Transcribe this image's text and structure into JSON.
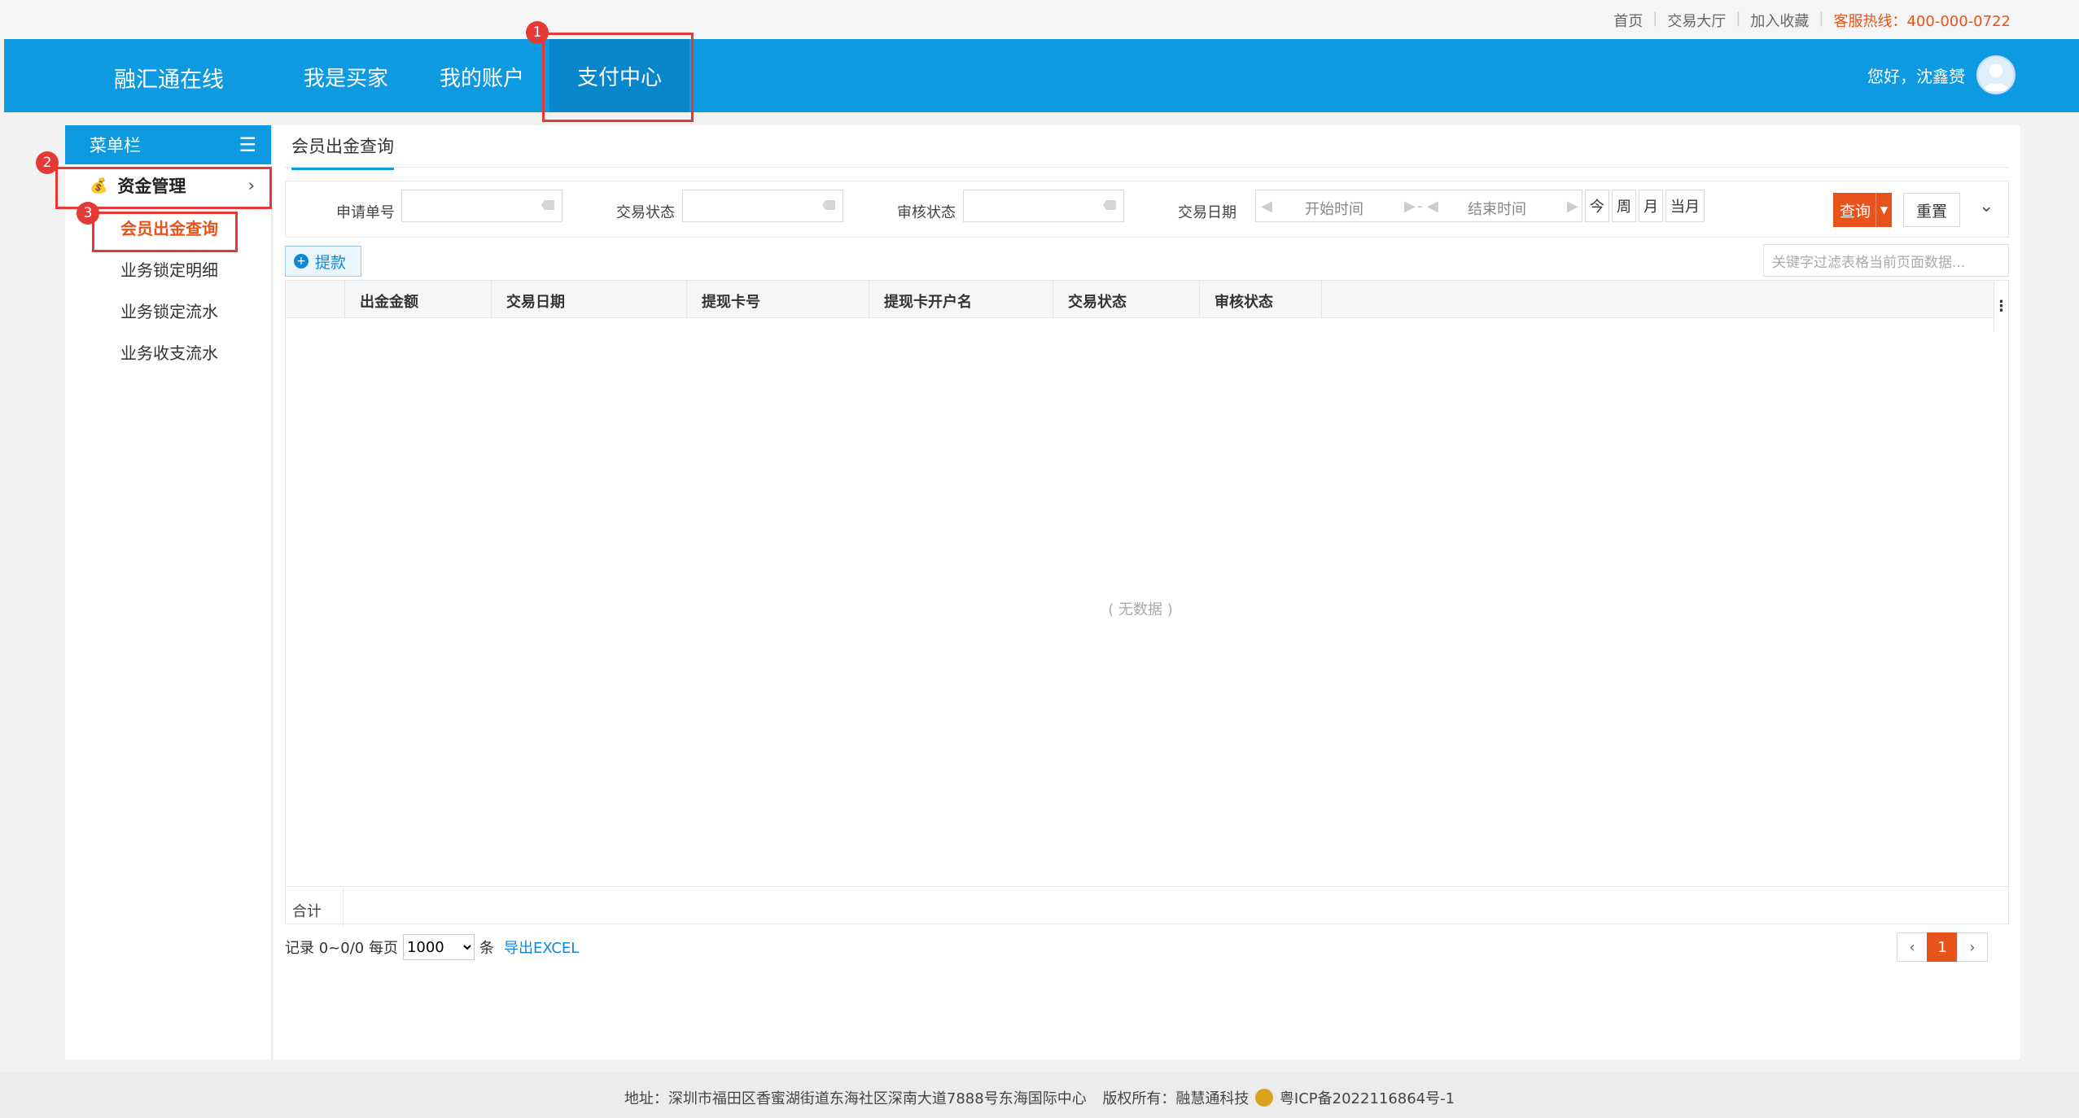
{
  "toplinks": {
    "home": "首页",
    "hall": "交易大厅",
    "fav": "加入收藏",
    "hotline": "客服热线：400-000-0722"
  },
  "nav": {
    "brand": "融汇通在线",
    "buyer": "我是买家",
    "account": "我的账户",
    "pay": "支付中心",
    "greeting": "您好，沈鑫赟"
  },
  "badges": {
    "b1": "1",
    "b2": "2",
    "b3": "3"
  },
  "sidebar": {
    "title": "菜单栏",
    "group": "资金管理",
    "items": [
      {
        "label": "会员出金查询"
      },
      {
        "label": "业务锁定明细"
      },
      {
        "label": "业务锁定流水"
      },
      {
        "label": "业务收支流水"
      }
    ]
  },
  "tab": "会员出金查询",
  "search": {
    "apply_no": "申请单号",
    "trade_status": "交易状态",
    "audit_status": "审核状态",
    "trade_date": "交易日期",
    "start": "开始时间",
    "end": "结束时间",
    "sep": "-",
    "today": "今",
    "week": "周",
    "month": "月",
    "cur_month": "当月",
    "query": "查询",
    "reset": "重置"
  },
  "toolbar": {
    "withdraw": "提款",
    "filter_placeholder": "关键字过滤表格当前页面数据..."
  },
  "table": {
    "columns": [
      "出金金额",
      "交易日期",
      "提现卡号",
      "提现卡开户名",
      "交易状态",
      "审核状态"
    ],
    "empty": "( 无数据 )",
    "total": "合计"
  },
  "pager": {
    "record": "记录 0~0/0 每页",
    "per_page": "1000",
    "unit": "条",
    "export": "导出EXCEL",
    "page": "1"
  },
  "footer": {
    "address": "地址：深圳市福田区香蜜湖街道东海社区深南大道7888号东海国际中心",
    "copyright": "版权所有：融慧通科技",
    "icp": "粤ICP备2022116864号-1"
  },
  "colors": {
    "primary": "#0e9ae1",
    "accent": "#e8531c",
    "highlight": "#e53935"
  }
}
